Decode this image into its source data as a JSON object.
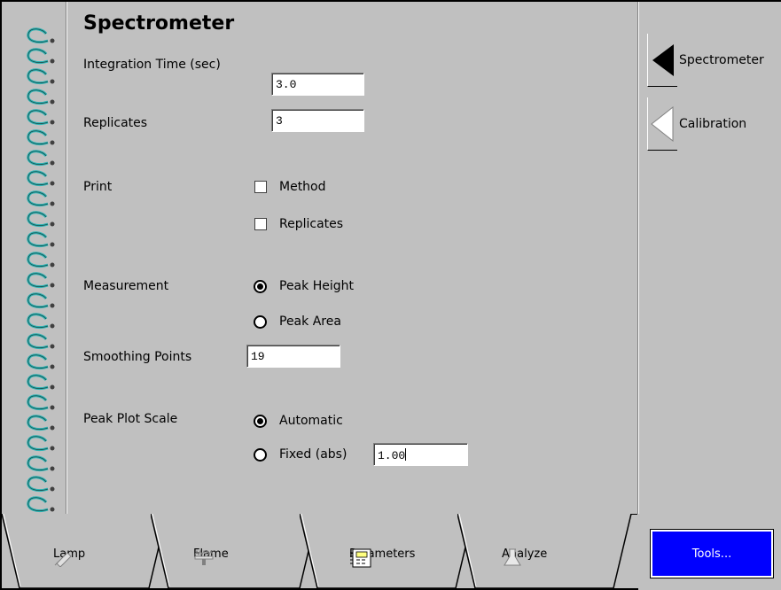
{
  "page": {
    "title": "Spectrometer",
    "integration_time_label": "Integration Time (sec)",
    "integration_time_value": "3.0",
    "replicates_label": "Replicates",
    "replicates_value": "3",
    "print_label": "Print",
    "print_method_label": "Method",
    "print_replicates_label": "Replicates",
    "measurement_label": "Measurement",
    "peak_height_label": "Peak Height",
    "peak_area_label": "Peak Area",
    "smoothing_points_label": "Smoothing Points",
    "smoothing_points_value": "19",
    "peak_plot_scale_label": "Peak Plot Scale",
    "automatic_label": "Automatic",
    "fixed_label": "Fixed (abs)",
    "fixed_value": "1.00",
    "measurement_selected": "Peak Height",
    "peak_plot_scale_selected": "Automatic",
    "print_method_checked": false,
    "print_replicates_checked": false
  },
  "side_tabs": [
    {
      "label": "Spectrometer",
      "active": true
    },
    {
      "label": "Calibration",
      "active": false
    }
  ],
  "bottom_tabs": [
    {
      "label": "Lamp",
      "icon": "lamp-icon"
    },
    {
      "label": "Flame",
      "icon": "flame-icon"
    },
    {
      "label": "Parameters",
      "icon": "parameters-icon",
      "active": true
    },
    {
      "label": "Analyze",
      "icon": "analyze-icon"
    }
  ],
  "tools_button_label": "Tools...",
  "colors": {
    "background": "#c0c0c0",
    "tools_button": "#0000ff",
    "spiral": "#2ab3b3"
  }
}
